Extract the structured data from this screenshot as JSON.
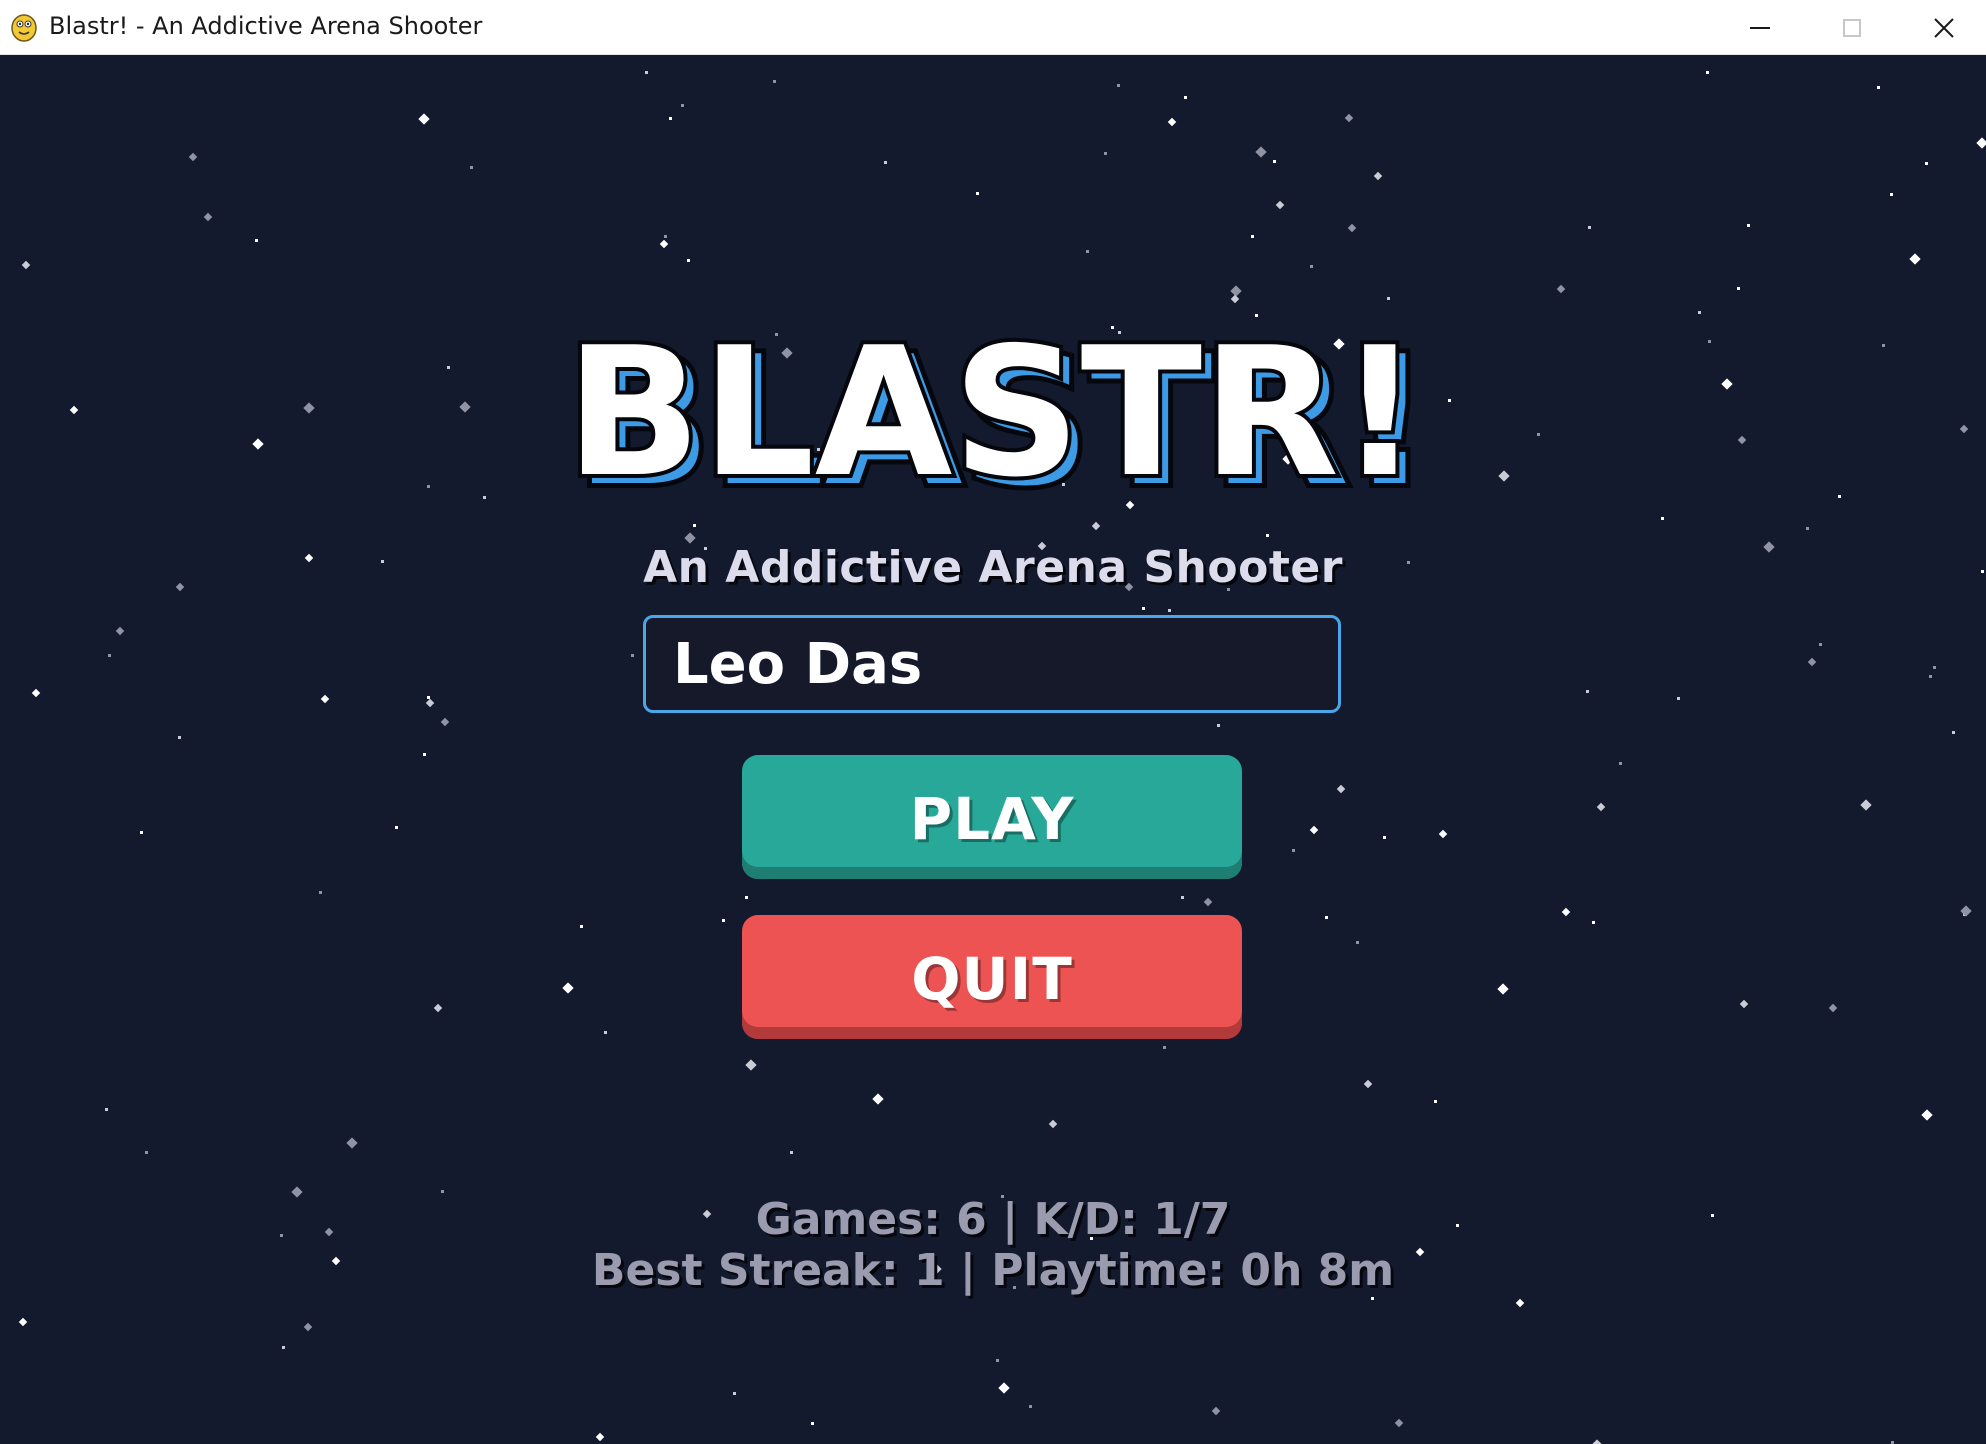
{
  "window": {
    "title": "Blastr! - An Addictive Arena Shooter",
    "app_icon": "python-icon",
    "controls": [
      "minimize-icon",
      "maximize-icon",
      "close-icon"
    ]
  },
  "game": {
    "logo_text": "BLASTR!",
    "subtitle": "An Addictive Arena Shooter",
    "player_name": "Leo Das",
    "play_label": "PLAY",
    "quit_label": "QUIT",
    "stats": {
      "line1": "Games: 6 | K/D: 1/7",
      "line2": "Best Streak: 1 | Playtime: 0h 8m"
    }
  },
  "colors": {
    "background": "#131a2e",
    "logo_fill": "#ffffff",
    "logo_shadow": "#3d9be6",
    "input_border": "#4aa6e8",
    "play_button": "#27a898",
    "quit_button": "#ee5353",
    "stats_text": "#9b9bb0"
  }
}
